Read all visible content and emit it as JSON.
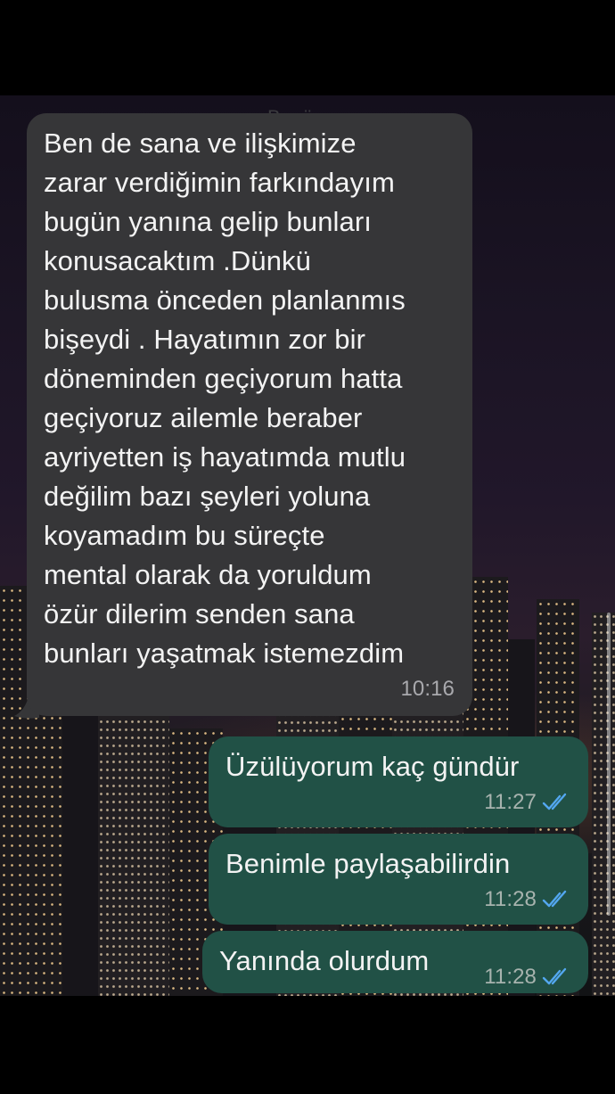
{
  "date_separator": "Bugün",
  "messages": [
    {
      "direction": "incoming",
      "lines": [
        "Ben de sana ve ilişkimize",
        "zarar verdiğimin farkındayım",
        "bugün yanına gelip bunları",
        "konusacaktım .Dünkü",
        "bulusma önceden planlanmıs",
        "bişeydi . Hayatımın zor bir",
        "döneminden geçiyorum hatta",
        "geçiyoruz ailemle beraber",
        "ayriyetten iş hayatımda mutlu",
        "değilim bazı şeyleri yoluna",
        "koyamadım bu süreçte",
        "mental olarak da yoruldum",
        "özür dilerim senden sana",
        "bunları yaşatmak istemezdim"
      ],
      "time": "10:16"
    },
    {
      "direction": "outgoing",
      "text": "Üzülüyorum kaç gündür",
      "time": "11:27",
      "status_icon": "double-check-read-icon"
    },
    {
      "direction": "outgoing",
      "text": "Benimle paylaşabilirdin",
      "time": "11:28",
      "status_icon": "double-check-read-icon"
    },
    {
      "direction": "outgoing",
      "text": "Yanında olurdum",
      "time": "11:28",
      "status_icon": "double-check-read-icon"
    }
  ],
  "colors": {
    "incoming_bubble": "#363638",
    "outgoing_bubble": "#215146",
    "read_check": "#53a7f0"
  }
}
